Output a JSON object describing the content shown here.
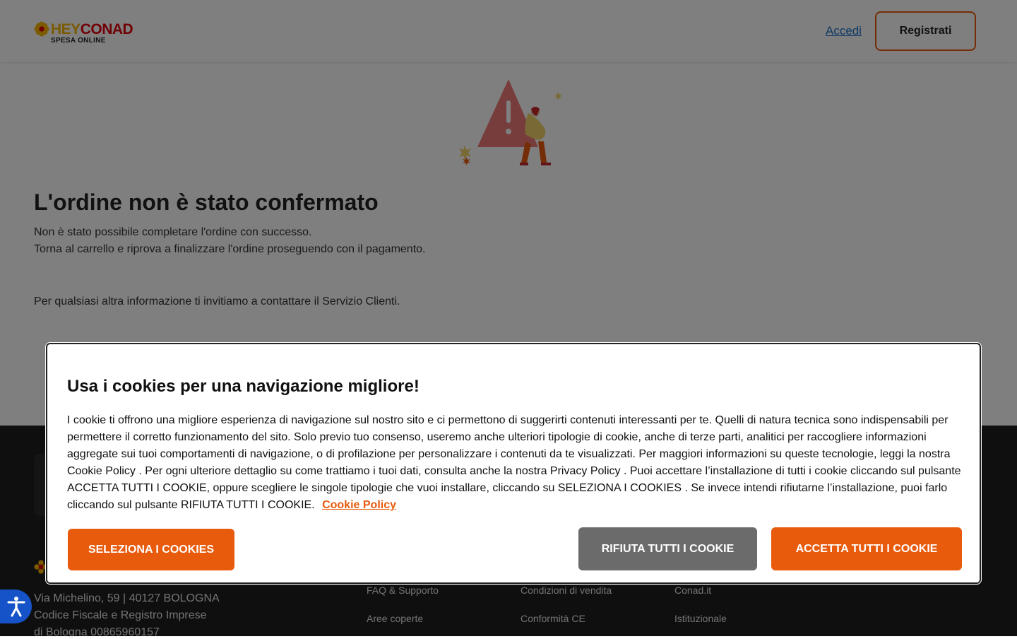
{
  "header": {
    "logo": {
      "brand_hey": "HEY",
      "brand_conad": "CONAD",
      "tagline": "SPESA ONLINE"
    },
    "login_label": "Accedi",
    "register_label": "Registrati"
  },
  "main": {
    "title": "L'ordine non è stato confermato",
    "message_line1": "Non è stato possibile completare l'ordine con successo.",
    "message_line2": "Torna al carrello e riprova a finalizzare l'ordine proseguendo con il pagamento.",
    "contact_line": "Per qualsiasi altra informazione ti invitiamo a contattare il Servizio Clienti."
  },
  "footer": {
    "address_line1": "Via Michelino, 59 | 40127 BOLOGNA",
    "address_line2": "Codice Fiscale e Registro Imprese",
    "address_line3": "di Bologna 00865960157",
    "links_col1": [
      "FAQ & Supporto",
      "Aree coperte"
    ],
    "links_col2": [
      "Condizioni di vendita",
      "Conformità CE"
    ],
    "links_col3": [
      "Conad.it",
      "Istituzionale"
    ]
  },
  "cookie_banner": {
    "title": "Usa i cookies per una navigazione migliore!",
    "body": "I cookie ti offrono una migliore esperienza di navigazione sul nostro sito e ci permettono di suggerirti contenuti interessanti per te. Quelli di natura tecnica sono indispensabili per permettere il corretto funzionamento del sito. Solo previo tuo consenso, useremo anche ulteriori tipologie di cookie, anche di terze parti, analitici per raccogliere informazioni aggregate sui tuoi comportamenti di navigazione, o di profilazione per personalizzare i contenuti da te visualizzati. Per maggiori informazioni su queste tecnologie, leggi la nostra Cookie Policy . Per ogni ulteriore dettaglio su come trattiamo i tuoi dati, consulta anche la nostra Privacy Policy . Puoi accettare l’installazione di tutti i cookie cliccando sul pulsante ACCETTA TUTTI I COOKIE, oppure scegliere le singole tipologie che vuoi installare, cliccando su SELEZIONA I COOKIES . Se invece intendi rifiutarne l’installazione, puoi farlo cliccando sul pulsante RIFIUTA TUTTI I COOKIE.",
    "policy_link": "Cookie Policy",
    "select_label": "SELEZIONA I COOKIES",
    "reject_label": "RIFIUTA TUTTI I COOKIE",
    "accept_label": "ACCETTA TUTTI I COOKIE"
  },
  "accessibility": {
    "icon": "accessibility-icon"
  },
  "colors": {
    "brand_orange": "#e85a0c",
    "link_blue": "#1a73c9",
    "reject_gray": "#6b6b6b",
    "accessibility_blue": "#1652c8",
    "footer_bg": "#1f1f1f"
  }
}
